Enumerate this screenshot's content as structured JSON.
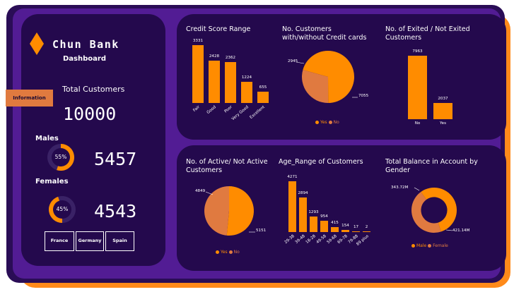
{
  "brand": {
    "name": "Chun Bank",
    "subtitle": "Dashboard"
  },
  "sidebar": {
    "info_button": "Information",
    "total_label": "Total Customers",
    "total_value": "10000",
    "males_label": "Males",
    "males_pct": "55%",
    "males_pct_value": 0.55,
    "males_value": "5457",
    "females_label": "Females",
    "females_pct": "45%",
    "females_pct_value": 0.45,
    "females_value": "4543",
    "filters": [
      "France",
      "Germany",
      "Spain"
    ]
  },
  "colors": {
    "accent": "#ff8c00",
    "secondary": "#e07a40",
    "panel": "#24094d",
    "background": "#521c94"
  },
  "chart_data": [
    {
      "type": "bar",
      "title": "Credit Score Range",
      "categories": [
        "Fair",
        "Good",
        "Poor",
        "Very Good",
        "Excellent"
      ],
      "values": [
        3331,
        2428,
        2362,
        1224,
        655
      ],
      "data_labels": [
        "3331",
        "2428",
        "2362",
        "1224",
        "655"
      ]
    },
    {
      "type": "pie",
      "title": "No. Customers with/without Credit cards",
      "series": [
        {
          "name": "Yes",
          "value": 7055
        },
        {
          "name": "No",
          "value": 2945
        }
      ],
      "data_labels": [
        "7055",
        "2945"
      ],
      "legend": [
        "Yes",
        "No"
      ]
    },
    {
      "type": "bar",
      "title": "No. of Exited / Not Exited Customers",
      "categories": [
        "No",
        "Yes"
      ],
      "values": [
        7963,
        2037
      ],
      "data_labels": [
        "7963",
        "2037"
      ]
    },
    {
      "type": "pie",
      "title": "No. of Active/ Not Active Customers",
      "series": [
        {
          "name": "Yes",
          "value": 5151
        },
        {
          "name": "No",
          "value": 4849
        }
      ],
      "data_labels": [
        "5151",
        "4849"
      ],
      "legend": [
        "Yes",
        "No"
      ]
    },
    {
      "type": "bar",
      "title": "Age_Range of Customers",
      "categories": [
        "29-38",
        "39-48",
        "18-28",
        "49-58",
        "59-68",
        "69-78",
        "79-88",
        "89 plus"
      ],
      "values": [
        4271,
        2894,
        1293,
        954,
        415,
        154,
        17,
        2
      ],
      "data_labels": [
        "4271",
        "2894",
        "1293",
        "954",
        "415",
        "154",
        "17",
        "2"
      ]
    },
    {
      "type": "pie",
      "title": "Total Balance in Account by Gender",
      "series": [
        {
          "name": "Male",
          "value": 421.14
        },
        {
          "name": "Female",
          "value": 343.72
        }
      ],
      "data_labels": [
        "421.14M",
        "343.72M"
      ],
      "legend": [
        "Male",
        "Female"
      ],
      "donut": true
    }
  ]
}
